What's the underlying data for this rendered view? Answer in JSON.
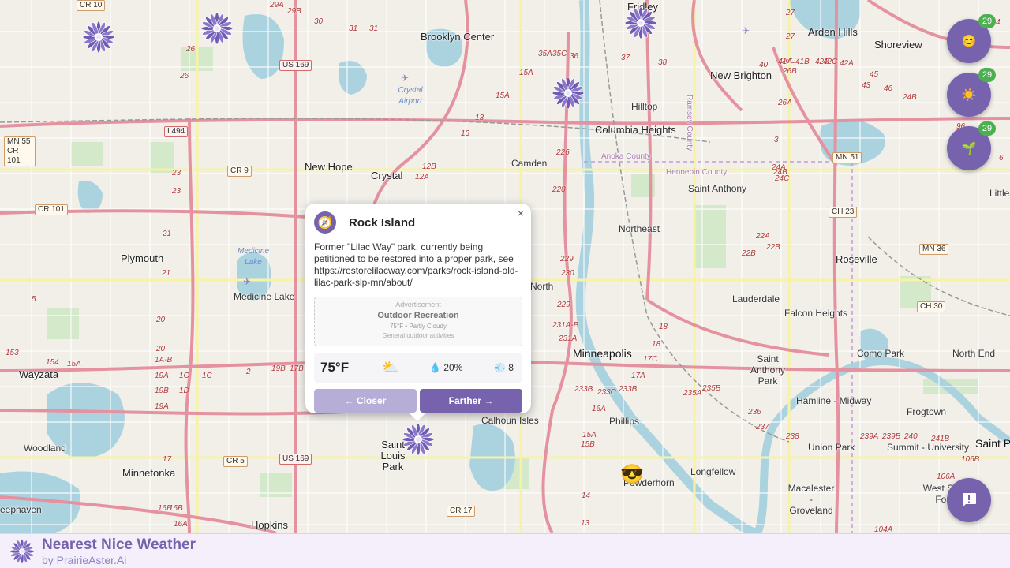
{
  "map": {
    "places": [
      {
        "text": "Brooklyn Center",
        "cls": "big"
      },
      {
        "text": "Arden Hills",
        "cls": "big"
      },
      {
        "text": "Shoreview",
        "cls": "big"
      },
      {
        "text": "New Brighton",
        "cls": "big"
      },
      {
        "text": "Columbia Heights",
        "cls": "big"
      },
      {
        "text": "Hilltop",
        "cls": ""
      },
      {
        "text": "Fridley",
        "cls": "big"
      },
      {
        "text": "Crystal",
        "cls": "big"
      },
      {
        "text": "New Hope",
        "cls": "big"
      },
      {
        "text": "Camden",
        "cls": ""
      },
      {
        "text": "Saint Anthony",
        "cls": ""
      },
      {
        "text": "Plymouth",
        "cls": "big"
      },
      {
        "text": "Northeast",
        "cls": ""
      },
      {
        "text": "Roseville",
        "cls": "big"
      },
      {
        "text": "Lauderdale",
        "cls": ""
      },
      {
        "text": "Falcon Heights",
        "cls": ""
      },
      {
        "text": "Medicine Lake",
        "cls": ""
      },
      {
        "text": "North",
        "cls": ""
      },
      {
        "text": "Minneapolis",
        "cls": "city"
      },
      {
        "text": "Saint Anthony Park",
        "cls": ""
      },
      {
        "text": "Como Park",
        "cls": ""
      },
      {
        "text": "North End",
        "cls": ""
      },
      {
        "text": "Wayzata",
        "cls": "big"
      },
      {
        "text": "Hamline - Midway",
        "cls": ""
      },
      {
        "text": "Frogtown",
        "cls": ""
      },
      {
        "text": "Calhoun Isles",
        "cls": ""
      },
      {
        "text": "Phillips",
        "cls": ""
      },
      {
        "text": "Saint Louis Park",
        "cls": "big"
      },
      {
        "text": "Union Park",
        "cls": ""
      },
      {
        "text": "Summit - University",
        "cls": ""
      },
      {
        "text": "Saint P",
        "cls": "city"
      },
      {
        "text": "Woodland",
        "cls": ""
      },
      {
        "text": "Minnetonka",
        "cls": "big"
      },
      {
        "text": "Powderhorn",
        "cls": ""
      },
      {
        "text": "Longfellow",
        "cls": ""
      },
      {
        "text": "Macalester - Groveland",
        "cls": ""
      },
      {
        "text": "West Se - Fort",
        "cls": ""
      },
      {
        "text": "Hopkins",
        "cls": "big"
      },
      {
        "text": "eephaven",
        "cls": ""
      },
      {
        "text": "Little",
        "cls": ""
      }
    ],
    "water_labels": [
      "Crystal Airport",
      "Medicine Lake"
    ],
    "county_labels": [
      "Anoka County",
      "Hennepin County",
      "Ramsey County"
    ],
    "shields": [
      "CR 10",
      "US 169",
      "I 494",
      "MN 55 CR 101",
      "CR 9",
      "CR 101",
      "MN 51",
      "CH 23",
      "MN 36",
      "CH 30",
      "CR 5",
      "US 169",
      "CR 17"
    ],
    "route_numbers": [
      "29A",
      "29B",
      "30",
      "31",
      "31",
      "26",
      "26",
      "35A",
      "35C",
      "36",
      "37",
      "38",
      "15A",
      "15A",
      "13",
      "13",
      "12B",
      "12A",
      "226",
      "228",
      "23",
      "23",
      "21",
      "21",
      "20",
      "20",
      "19A",
      "19B",
      "19A",
      "1C",
      "1D",
      "1C",
      "154",
      "15A",
      "153",
      "229",
      "230",
      "229",
      "231A-B",
      "231A",
      "233B",
      "233C",
      "233B",
      "17C",
      "17A",
      "18",
      "18",
      "235A",
      "235B",
      "236",
      "237",
      "238",
      "239A",
      "239B",
      "240",
      "241B",
      "106B",
      "106A",
      "104A",
      "16A",
      "16B",
      "15A",
      "15B",
      "14",
      "13",
      "17",
      "16B",
      "16A",
      "22A",
      "22B",
      "22B",
      "24A",
      "24B",
      "24C",
      "26A",
      "26B",
      "26C",
      "27",
      "27",
      "40",
      "41A",
      "41B",
      "42B",
      "42C",
      "42A",
      "43",
      "45",
      "46",
      "24B",
      "96",
      "6",
      "3",
      "4",
      "5",
      "2",
      "19B",
      "17B",
      "19A",
      "1A-B"
    ]
  },
  "side_buttons": [
    {
      "icon_name": "smiley-icon",
      "icon": "😊",
      "badge": "29"
    },
    {
      "icon_name": "sun-icon",
      "icon": "☀️",
      "badge": "29"
    },
    {
      "icon_name": "seedling-icon",
      "icon": "🌱",
      "badge": "29"
    }
  ],
  "popup": {
    "icon_name": "compass-icon",
    "icon": "🧭",
    "title": "Rock Island",
    "close": "×",
    "description": "Former \"Lilac Way\" park, currently being petitioned to be restored into a proper park, see https://restorelilacway.com/parks/rock-island-old-lilac-park-slp-mn/about/",
    "ad": {
      "label": "Advertisement",
      "title": "Outdoor Recreation",
      "line1": "75°F • Partly Cloudy",
      "line2": "General outdoor activities"
    },
    "weather": {
      "temp": "75°F",
      "condition_icon": "⛅",
      "rain": "💧 20%",
      "wind": "💨 8"
    },
    "closer": "← Closer",
    "farther": "Farther →"
  },
  "marker_emoji": "😎",
  "footer": {
    "title": "Nearest Nice Weather",
    "subtitle": "by PrairieAster.Ai"
  },
  "colors": {
    "accent": "#7762ae",
    "badge": "#4caf50",
    "footer_bg": "#f4effa"
  }
}
